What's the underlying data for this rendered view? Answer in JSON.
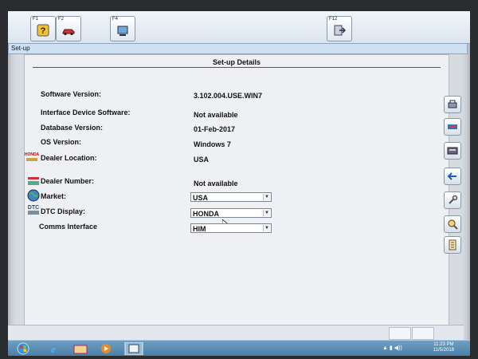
{
  "toolbar": {
    "keys": [
      {
        "label": "F1",
        "icon": "help-icon"
      },
      {
        "label": "F2",
        "icon": "car-icon"
      },
      {
        "label": "F4",
        "icon": "tool-icon"
      },
      {
        "label": "F12",
        "icon": "exit-icon"
      }
    ]
  },
  "window": {
    "title": "Set-up"
  },
  "details": {
    "heading": "Set-up Details",
    "rows": [
      {
        "label": "Software Version:",
        "value": "3.102.004.USE.WIN7"
      },
      {
        "label": "Interface Device Software:",
        "value": "Not available"
      },
      {
        "label": "Database Version:",
        "value": "01-Feb-2017"
      },
      {
        "label": "OS Version:",
        "value": "Windows 7"
      },
      {
        "label": "Dealer Location:",
        "value": "USA"
      },
      {
        "label": "Dealer Number:",
        "value": "Not available"
      },
      {
        "label": "Market:",
        "value": "USA"
      },
      {
        "label": "DTC Display:",
        "value": "HONDA"
      },
      {
        "label": "Comms Interface",
        "value": "HIM"
      }
    ]
  },
  "taskbar": {
    "time": "11:23 PM",
    "date": "11/5/2018"
  },
  "colors": {
    "toolbar_bg": "#dbe4ee",
    "taskbar_bg": "#4a7fa6",
    "panel_bg": "#eef0f3"
  }
}
